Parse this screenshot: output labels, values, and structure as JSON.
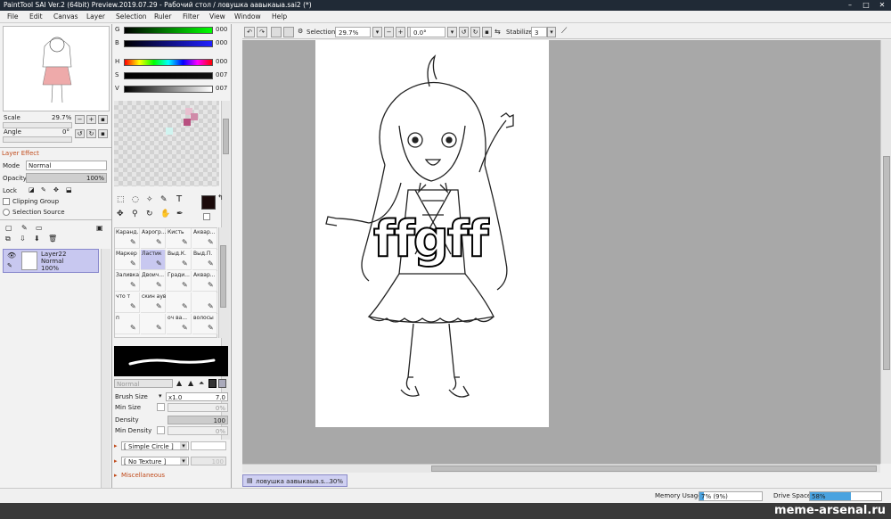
{
  "window": {
    "title": "PaintTool SAI Ver.2 (64bit) Preview.2019.07.29 - Рабочий стол / ловушка аавыкаыа.sai2 (*)"
  },
  "menu": [
    "File",
    "Edit",
    "Canvas",
    "Layer",
    "Selection",
    "Ruler",
    "Filter",
    "View",
    "Window",
    "Help"
  ],
  "navigator": {
    "scale_label": "Scale",
    "scale_value": "29.7%",
    "angle_label": "Angle",
    "angle_value": "0°"
  },
  "color": {
    "g_label": "G",
    "g_value": "000",
    "b_label": "B",
    "b_value": "000",
    "h_label": "H",
    "h_value": "000",
    "s_label": "S",
    "s_value": "007",
    "v_label": "V",
    "v_value": "007"
  },
  "layer_effect": {
    "header": "Layer Effect",
    "mode_label": "Mode",
    "mode_value": "Normal",
    "opacity_label": "Opacity",
    "opacity_value": "100%",
    "lock_label": "Lock",
    "clipping": "Clipping Group",
    "selection_source": "Selection Source"
  },
  "layer": {
    "name": "Layer22",
    "mode": "Normal",
    "opacity": "100%"
  },
  "tools": [
    [
      "Каранд.",
      "Аэрогр...",
      "Кисть",
      "Аквар..."
    ],
    [
      "Маркер",
      "Ластик",
      "Выд.К.",
      "Выд.П."
    ],
    [
      "Заливка",
      "Двоич...",
      "Гради...",
      "Аквар..."
    ],
    [
      "что т",
      "скин аув",
      "",
      ""
    ],
    [
      "п",
      "",
      "оч ва...",
      "волосы"
    ]
  ],
  "brush": {
    "mode": "Normal",
    "size_label": "Brush Size",
    "size_mult": "x1.0",
    "size_value": "7.0",
    "min_size_label": "Min Size",
    "min_size_value": "0%",
    "density_label": "Density",
    "density_value": "100",
    "min_density_label": "Min Density",
    "min_density_value": "0%",
    "shape": "[ Simple Circle ]",
    "texture": "[ No Texture ]",
    "texture_value": "100",
    "misc": "Miscellaneous"
  },
  "toolbar": {
    "selection_label": "Selection",
    "zoom": "29.7%",
    "angle": "0.0°",
    "stabilizer_label": "Stabilizer",
    "stabilizer_value": "3"
  },
  "canvas": {
    "text_overlay": "ffgff"
  },
  "status": {
    "doc_name": "ловушка аавыкаыа.s...",
    "doc_zoom": "30%",
    "memory_label": "Memory Usage",
    "memory_value": "7% (9%)",
    "memory_fraction": 0.07,
    "drive_label": "Drive Space",
    "drive_value": "58%",
    "drive_fraction": 0.58
  },
  "watermark": "meme-arsenal.ru",
  "colors": {
    "accent": "#c04a1a",
    "selection": "#c8c8f0",
    "highlight": "#4aa3e0",
    "titlebar": "#202a36"
  }
}
